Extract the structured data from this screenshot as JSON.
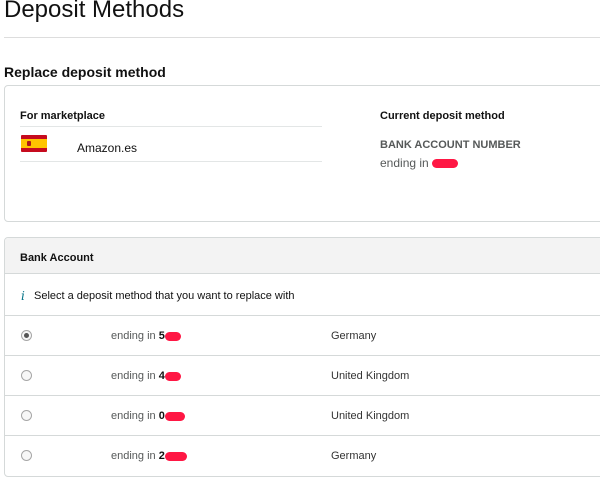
{
  "page": {
    "title": "Deposit Methods",
    "section_title": "Replace deposit method"
  },
  "marketplace": {
    "header": "For marketplace",
    "name": "Amazon.es",
    "flag_icon": "spain-flag-icon"
  },
  "current_deposit": {
    "header": "Current deposit method",
    "label": "BANK ACCOUNT NUMBER",
    "ending_prefix": "ending in"
  },
  "bank": {
    "title": "Bank Account",
    "info_icon": "i",
    "info_text": "Select a deposit method that you want to replace with",
    "accounts": [
      {
        "ending_prefix": "ending in",
        "digits": "5",
        "country": "Germany",
        "selected": true
      },
      {
        "ending_prefix": "ending in",
        "digits": "4",
        "country": "United Kingdom",
        "selected": false
      },
      {
        "ending_prefix": "ending in",
        "digits": "0",
        "country": "United Kingdom",
        "selected": false
      },
      {
        "ending_prefix": "ending in",
        "digits": "2",
        "country": "Germany",
        "selected": false
      }
    ]
  },
  "colors": {
    "redaction": "#ff1744",
    "info_icon": "#007185",
    "header_bg": "#f3f3f3",
    "border": "#d5d9d9"
  }
}
